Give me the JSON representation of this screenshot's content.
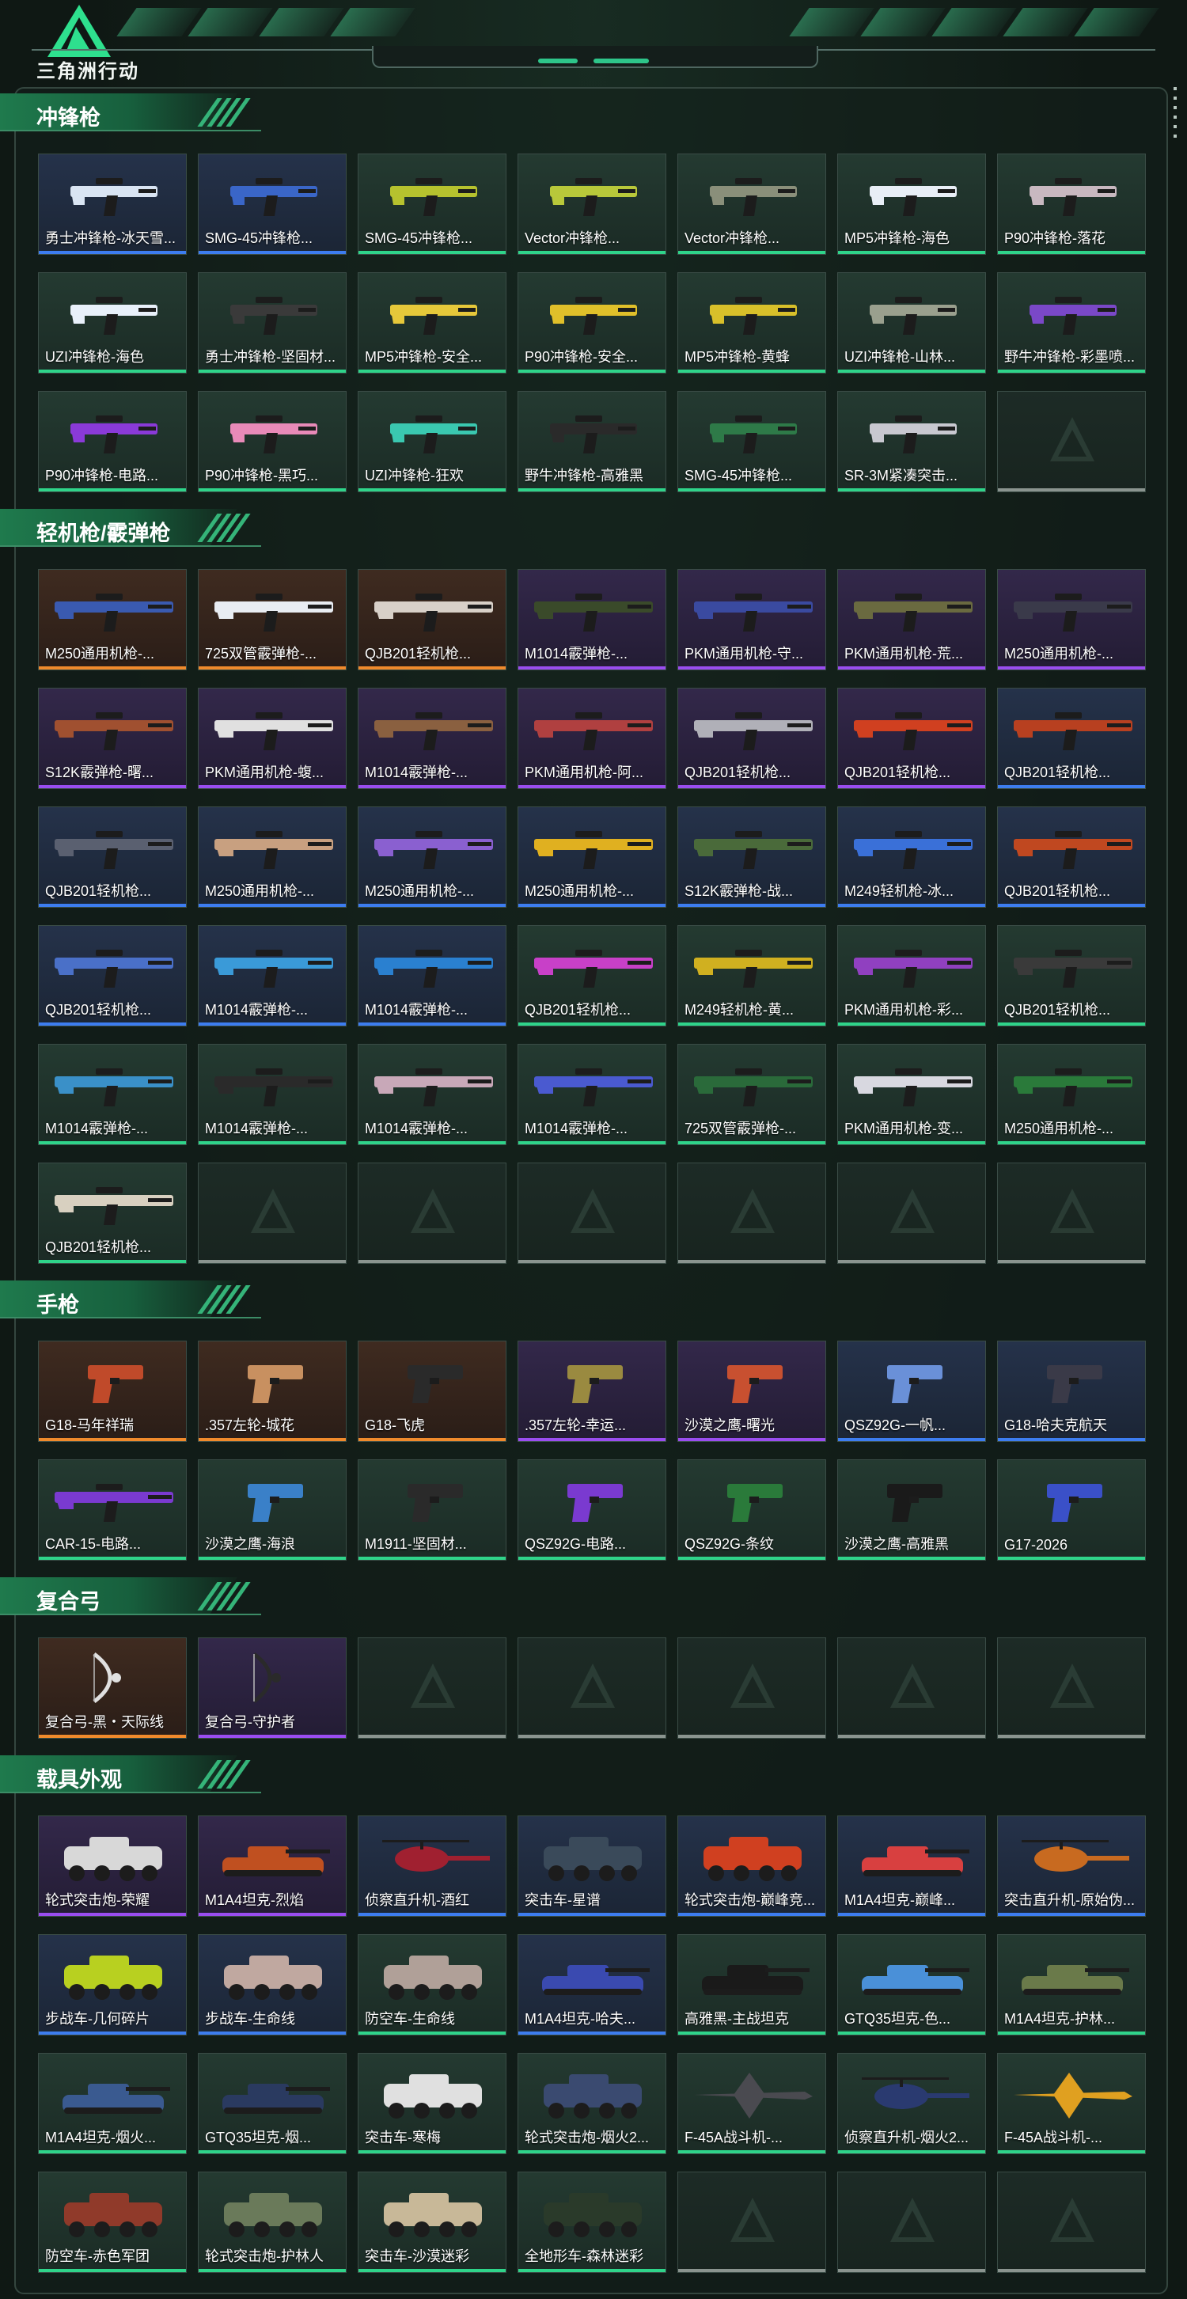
{
  "header": {
    "app_title": "三角洲行动"
  },
  "sections": [
    {
      "title": "冲锋枪",
      "items": [
        {
          "label": "勇士冲锋枪-冰天雪...",
          "rarity": "blue",
          "icon": "smg-skin-icon",
          "color": "#d9e4f2"
        },
        {
          "label": "SMG-45冲锋枪...",
          "rarity": "blue",
          "icon": "smg-skin-icon",
          "color": "#3a66c8"
        },
        {
          "label": "SMG-45冲锋枪...",
          "rarity": "green",
          "icon": "smg-skin-icon",
          "color": "#b6c22e"
        },
        {
          "label": "Vector冲锋枪...",
          "rarity": "green",
          "icon": "smg-skin-icon",
          "color": "#b8c83a"
        },
        {
          "label": "Vector冲锋枪...",
          "rarity": "green",
          "icon": "smg-skin-icon",
          "color": "#8a8f7a"
        },
        {
          "label": "MP5冲锋枪-海色",
          "rarity": "green",
          "icon": "smg-skin-icon",
          "color": "#e8eef6"
        },
        {
          "label": "P90冲锋枪-落花",
          "rarity": "green",
          "icon": "smg-skin-icon",
          "color": "#c8b8c0"
        },
        {
          "label": "UZI冲锋枪-海色",
          "rarity": "green",
          "icon": "smg-skin-icon",
          "color": "#e8f0fa"
        },
        {
          "label": "勇士冲锋枪-坚固材...",
          "rarity": "green",
          "icon": "smg-skin-icon",
          "color": "#3a3a3a"
        },
        {
          "label": "MP5冲锋枪-安全...",
          "rarity": "green",
          "icon": "smg-skin-icon",
          "color": "#e6c83a"
        },
        {
          "label": "P90冲锋枪-安全...",
          "rarity": "green",
          "icon": "smg-skin-icon",
          "color": "#e0c02a"
        },
        {
          "label": "MP5冲锋枪-黄蜂",
          "rarity": "green",
          "icon": "smg-skin-icon",
          "color": "#d8c02a"
        },
        {
          "label": "UZI冲锋枪-山林...",
          "rarity": "green",
          "icon": "smg-skin-icon",
          "color": "#9aa08e"
        },
        {
          "label": "野牛冲锋枪-彩墨喷...",
          "rarity": "green",
          "icon": "smg-skin-icon",
          "color": "#7a48c8"
        },
        {
          "label": "P90冲锋枪-电路...",
          "rarity": "green",
          "icon": "smg-skin-icon",
          "color": "#8a3ad8"
        },
        {
          "label": "P90冲锋枪-黑巧...",
          "rarity": "green",
          "icon": "smg-skin-icon",
          "color": "#e88ab8"
        },
        {
          "label": "UZI冲锋枪-狂欢",
          "rarity": "green",
          "icon": "smg-skin-icon",
          "color": "#3ac8b0"
        },
        {
          "label": "野牛冲锋枪-高雅黑",
          "rarity": "green",
          "icon": "smg-skin-icon",
          "color": "#2a2a2a"
        },
        {
          "label": "SMG-45冲锋枪...",
          "rarity": "green",
          "icon": "smg-skin-icon",
          "color": "#2e7a48"
        },
        {
          "label": "SR-3M紧凑突击...",
          "rarity": "green",
          "icon": "smg-skin-icon",
          "color": "#c8c8d0"
        },
        {
          "label": "",
          "rarity": "empty",
          "icon": "empty-slot-icon",
          "color": ""
        }
      ]
    },
    {
      "title": "轻机枪/霰弹枪",
      "items": [
        {
          "label": "M250通用机枪-...",
          "rarity": "orange",
          "icon": "lmg-skin-icon",
          "color": "#3a5ab0"
        },
        {
          "label": "725双管霰弹枪-...",
          "rarity": "orange",
          "icon": "shotgun-skin-icon",
          "color": "#e8ecf2"
        },
        {
          "label": "QJB201轻机枪...",
          "rarity": "orange",
          "icon": "lmg-skin-icon",
          "color": "#d8d0c8"
        },
        {
          "label": "M1014霰弹枪-...",
          "rarity": "purple",
          "icon": "shotgun-skin-icon",
          "color": "#3a4a2a"
        },
        {
          "label": "PKM通用机枪-守...",
          "rarity": "purple",
          "icon": "lmg-skin-icon",
          "color": "#3a4aa0"
        },
        {
          "label": "PKM通用机枪-荒...",
          "rarity": "purple",
          "icon": "lmg-skin-icon",
          "color": "#6a6a40"
        },
        {
          "label": "M250通用机枪-...",
          "rarity": "purple",
          "icon": "lmg-skin-icon",
          "color": "#3a3a4a"
        },
        {
          "label": "S12K霰弹枪-曙...",
          "rarity": "purple",
          "icon": "shotgun-skin-icon",
          "color": "#a05030"
        },
        {
          "label": "PKM通用机枪-蝮...",
          "rarity": "purple",
          "icon": "lmg-skin-icon",
          "color": "#e0e0e0"
        },
        {
          "label": "M1014霰弹枪-...",
          "rarity": "purple",
          "icon": "shotgun-skin-icon",
          "color": "#8a6040"
        },
        {
          "label": "PKM通用机枪-阿...",
          "rarity": "purple",
          "icon": "lmg-skin-icon",
          "color": "#b04040"
        },
        {
          "label": "QJB201轻机枪...",
          "rarity": "purple",
          "icon": "lmg-skin-icon",
          "color": "#b0b0b8"
        },
        {
          "label": "QJB201轻机枪...",
          "rarity": "purple",
          "icon": "lmg-skin-icon",
          "color": "#d04020"
        },
        {
          "label": "QJB201轻机枪...",
          "rarity": "blue",
          "icon": "lmg-skin-icon",
          "color": "#b84020"
        },
        {
          "label": "QJB201轻机枪...",
          "rarity": "blue",
          "icon": "lmg-skin-icon",
          "color": "#5a6070"
        },
        {
          "label": "M250通用机枪-...",
          "rarity": "blue",
          "icon": "lmg-skin-icon",
          "color": "#c8a080"
        },
        {
          "label": "M250通用机枪-...",
          "rarity": "blue",
          "icon": "lmg-skin-icon",
          "color": "#8a60d0"
        },
        {
          "label": "M250通用机枪-...",
          "rarity": "blue",
          "icon": "lmg-skin-icon",
          "color": "#e0b020"
        },
        {
          "label": "S12K霰弹枪-战...",
          "rarity": "blue",
          "icon": "shotgun-skin-icon",
          "color": "#4a6a3a"
        },
        {
          "label": "M249轻机枪-冰...",
          "rarity": "blue",
          "icon": "lmg-skin-icon",
          "color": "#3a70d8"
        },
        {
          "label": "QJB201轻机枪...",
          "rarity": "blue",
          "icon": "lmg-skin-icon",
          "color": "#c04820"
        },
        {
          "label": "QJB201轻机枪...",
          "rarity": "blue",
          "icon": "lmg-skin-icon",
          "color": "#4a70c8"
        },
        {
          "label": "M1014霰弹枪-...",
          "rarity": "blue",
          "icon": "shotgun-skin-icon",
          "color": "#3a9ad8"
        },
        {
          "label": "M1014霰弹枪-...",
          "rarity": "blue",
          "icon": "shotgun-skin-icon",
          "color": "#2a80d0"
        },
        {
          "label": "QJB201轻机枪...",
          "rarity": "green",
          "icon": "lmg-skin-icon",
          "color": "#c840c8"
        },
        {
          "label": "M249轻机枪-黄...",
          "rarity": "green",
          "icon": "lmg-skin-icon",
          "color": "#d0b020"
        },
        {
          "label": "PKM通用机枪-彩...",
          "rarity": "green",
          "icon": "lmg-skin-icon",
          "color": "#9040c0"
        },
        {
          "label": "QJB201轻机枪...",
          "rarity": "green",
          "icon": "lmg-skin-icon",
          "color": "#3a3a3a"
        },
        {
          "label": "M1014霰弹枪-...",
          "rarity": "green",
          "icon": "shotgun-skin-icon",
          "color": "#3a90c8"
        },
        {
          "label": "M1014霰弹枪-...",
          "rarity": "green",
          "icon": "shotgun-skin-icon",
          "color": "#2a2a2a"
        },
        {
          "label": "M1014霰弹枪-...",
          "rarity": "green",
          "icon": "shotgun-skin-icon",
          "color": "#c8a8b8"
        },
        {
          "label": "M1014霰弹枪-...",
          "rarity": "green",
          "icon": "shotgun-skin-icon",
          "color": "#4a5ad0"
        },
        {
          "label": "725双管霰弹枪-...",
          "rarity": "green",
          "icon": "shotgun-skin-icon",
          "color": "#2a6a3a"
        },
        {
          "label": "PKM通用机枪-变...",
          "rarity": "green",
          "icon": "lmg-skin-icon",
          "color": "#d8d8e0"
        },
        {
          "label": "M250通用机枪-...",
          "rarity": "green",
          "icon": "lmg-skin-icon",
          "color": "#2a7a3a"
        },
        {
          "label": "QJB201轻机枪...",
          "rarity": "green",
          "icon": "lmg-skin-icon",
          "color": "#d8d0c0"
        },
        {
          "label": "",
          "rarity": "empty",
          "icon": "empty-slot-icon",
          "color": ""
        },
        {
          "label": "",
          "rarity": "empty",
          "icon": "empty-slot-icon",
          "color": ""
        },
        {
          "label": "",
          "rarity": "empty",
          "icon": "empty-slot-icon",
          "color": ""
        },
        {
          "label": "",
          "rarity": "empty",
          "icon": "empty-slot-icon",
          "color": ""
        },
        {
          "label": "",
          "rarity": "empty",
          "icon": "empty-slot-icon",
          "color": ""
        },
        {
          "label": "",
          "rarity": "empty",
          "icon": "empty-slot-icon",
          "color": ""
        }
      ]
    },
    {
      "title": "手枪",
      "items": [
        {
          "label": "G18-马年祥瑞",
          "rarity": "orange",
          "icon": "pistol-skin-icon",
          "color": "#c04a2a"
        },
        {
          "label": ".357左轮-城花",
          "rarity": "orange",
          "icon": "revolver-skin-icon",
          "color": "#c89060"
        },
        {
          "label": "G18-飞虎",
          "rarity": "orange",
          "icon": "pistol-skin-icon",
          "color": "#2a2a2a"
        },
        {
          "label": ".357左轮-幸运...",
          "rarity": "purple",
          "icon": "revolver-skin-icon",
          "color": "#9a8a40"
        },
        {
          "label": "沙漠之鹰-曙光",
          "rarity": "purple",
          "icon": "pistol-skin-icon",
          "color": "#c85030"
        },
        {
          "label": "QSZ92G-一帆...",
          "rarity": "blue",
          "icon": "pistol-skin-icon",
          "color": "#6a90d8"
        },
        {
          "label": "G18-哈夫克航天",
          "rarity": "blue",
          "icon": "pistol-skin-icon",
          "color": "#3a3a48"
        },
        {
          "label": "CAR-15-电路...",
          "rarity": "green",
          "icon": "rifle-skin-icon",
          "color": "#7a3ad0"
        },
        {
          "label": "沙漠之鹰-海浪",
          "rarity": "green",
          "icon": "pistol-skin-icon",
          "color": "#3a80c8"
        },
        {
          "label": "M1911-坚固材...",
          "rarity": "green",
          "icon": "pistol-skin-icon",
          "color": "#2a2a2a"
        },
        {
          "label": "QSZ92G-电路...",
          "rarity": "green",
          "icon": "pistol-skin-icon",
          "color": "#7a3ad0"
        },
        {
          "label": "QSZ92G-条纹",
          "rarity": "green",
          "icon": "pistol-skin-icon",
          "color": "#2a7a3a"
        },
        {
          "label": "沙漠之鹰-高雅黑",
          "rarity": "green",
          "icon": "pistol-skin-icon",
          "color": "#1a1a1a"
        },
        {
          "label": "G17-2026",
          "rarity": "green",
          "icon": "pistol-skin-icon",
          "color": "#3a50c8"
        }
      ]
    },
    {
      "title": "复合弓",
      "items": [
        {
          "label": "复合弓-黑・天际线",
          "rarity": "orange",
          "icon": "bow-skin-icon",
          "color": "#e0e0e0"
        },
        {
          "label": "复合弓-守护者",
          "rarity": "purple",
          "icon": "bow-skin-icon",
          "color": "#2a2a2a"
        },
        {
          "label": "",
          "rarity": "empty",
          "icon": "empty-slot-icon",
          "color": ""
        },
        {
          "label": "",
          "rarity": "empty",
          "icon": "empty-slot-icon",
          "color": ""
        },
        {
          "label": "",
          "rarity": "empty",
          "icon": "empty-slot-icon",
          "color": ""
        },
        {
          "label": "",
          "rarity": "empty",
          "icon": "empty-slot-icon",
          "color": ""
        },
        {
          "label": "",
          "rarity": "empty",
          "icon": "empty-slot-icon",
          "color": ""
        }
      ]
    },
    {
      "title": "载具外观",
      "items": [
        {
          "label": "轮式突击炮-荣耀",
          "rarity": "purple",
          "icon": "vehicle-skin-icon",
          "color": "#d8d8d8"
        },
        {
          "label": "M1A4坦克-烈焰",
          "rarity": "purple",
          "icon": "tank-skin-icon",
          "color": "#c05020"
        },
        {
          "label": "侦察直升机-酒红",
          "rarity": "blue",
          "icon": "helicopter-skin-icon",
          "color": "#a02030"
        },
        {
          "label": "突击车-星谱",
          "rarity": "blue",
          "icon": "vehicle-skin-icon",
          "color": "#3a4a5a"
        },
        {
          "label": "轮式突击炮-巅峰竞...",
          "rarity": "blue",
          "icon": "vehicle-skin-icon",
          "color": "#d04020"
        },
        {
          "label": "M1A4坦克-巅峰...",
          "rarity": "blue",
          "icon": "tank-skin-icon",
          "color": "#d84040"
        },
        {
          "label": "突击直升机-原始伪...",
          "rarity": "blue",
          "icon": "helicopter-skin-icon",
          "color": "#c86a20"
        },
        {
          "label": "步战车-几何碎片",
          "rarity": "blue",
          "icon": "vehicle-skin-icon",
          "color": "#b8d020"
        },
        {
          "label": "步战车-生命线",
          "rarity": "blue",
          "icon": "vehicle-skin-icon",
          "color": "#c0a8a0"
        },
        {
          "label": "防空车-生命线",
          "rarity": "green",
          "icon": "vehicle-skin-icon",
          "color": "#b0a098"
        },
        {
          "label": "M1A4坦克-哈夫...",
          "rarity": "blue",
          "icon": "tank-skin-icon",
          "color": "#3a4ab0"
        },
        {
          "label": "高雅黑-主战坦克",
          "rarity": "green",
          "icon": "tank-skin-icon",
          "color": "#1a1a1a"
        },
        {
          "label": "GTQ35坦克-色...",
          "rarity": "green",
          "icon": "tank-skin-icon",
          "color": "#4a90d8"
        },
        {
          "label": "M1A4坦克-护林...",
          "rarity": "green",
          "icon": "tank-skin-icon",
          "color": "#6a7a4a"
        },
        {
          "label": "M1A4坦克-烟火...",
          "rarity": "green",
          "icon": "tank-skin-icon",
          "color": "#3a5a90"
        },
        {
          "label": "GTQ35坦克-烟...",
          "rarity": "green",
          "icon": "tank-skin-icon",
          "color": "#2a3a60"
        },
        {
          "label": "突击车-寒梅",
          "rarity": "green",
          "icon": "vehicle-skin-icon",
          "color": "#e0e0e0"
        },
        {
          "label": "轮式突击炮-烟火2...",
          "rarity": "green",
          "icon": "vehicle-skin-icon",
          "color": "#3a4a70"
        },
        {
          "label": "F-45A战斗机-...",
          "rarity": "green",
          "icon": "jet-skin-icon",
          "color": "#4a4a50"
        },
        {
          "label": "侦察直升机-烟火2...",
          "rarity": "green",
          "icon": "helicopter-skin-icon",
          "color": "#2a3a70"
        },
        {
          "label": "F-45A战斗机-...",
          "rarity": "green",
          "icon": "jet-skin-icon",
          "color": "#e0a020"
        },
        {
          "label": "防空车-赤色军团",
          "rarity": "green",
          "icon": "vehicle-skin-icon",
          "color": "#903a2a"
        },
        {
          "label": "轮式突击炮-护林人",
          "rarity": "green",
          "icon": "vehicle-skin-icon",
          "color": "#6a7a5a"
        },
        {
          "label": "突击车-沙漠迷彩",
          "rarity": "green",
          "icon": "vehicle-skin-icon",
          "color": "#c8b898"
        },
        {
          "label": "全地形车-森林迷彩",
          "rarity": "green",
          "icon": "vehicle-skin-icon",
          "color": "#2a3a2a"
        },
        {
          "label": "",
          "rarity": "empty",
          "icon": "empty-slot-icon",
          "color": ""
        },
        {
          "label": "",
          "rarity": "empty",
          "icon": "empty-slot-icon",
          "color": ""
        },
        {
          "label": "",
          "rarity": "empty",
          "icon": "empty-slot-icon",
          "color": ""
        }
      ]
    }
  ],
  "colors": {
    "green": "#2fd48a",
    "blue": "#3d7df0",
    "purple": "#9a4df0",
    "orange": "#f08a2c",
    "empty": "#8a948f",
    "accent": "#1f7a4d"
  }
}
